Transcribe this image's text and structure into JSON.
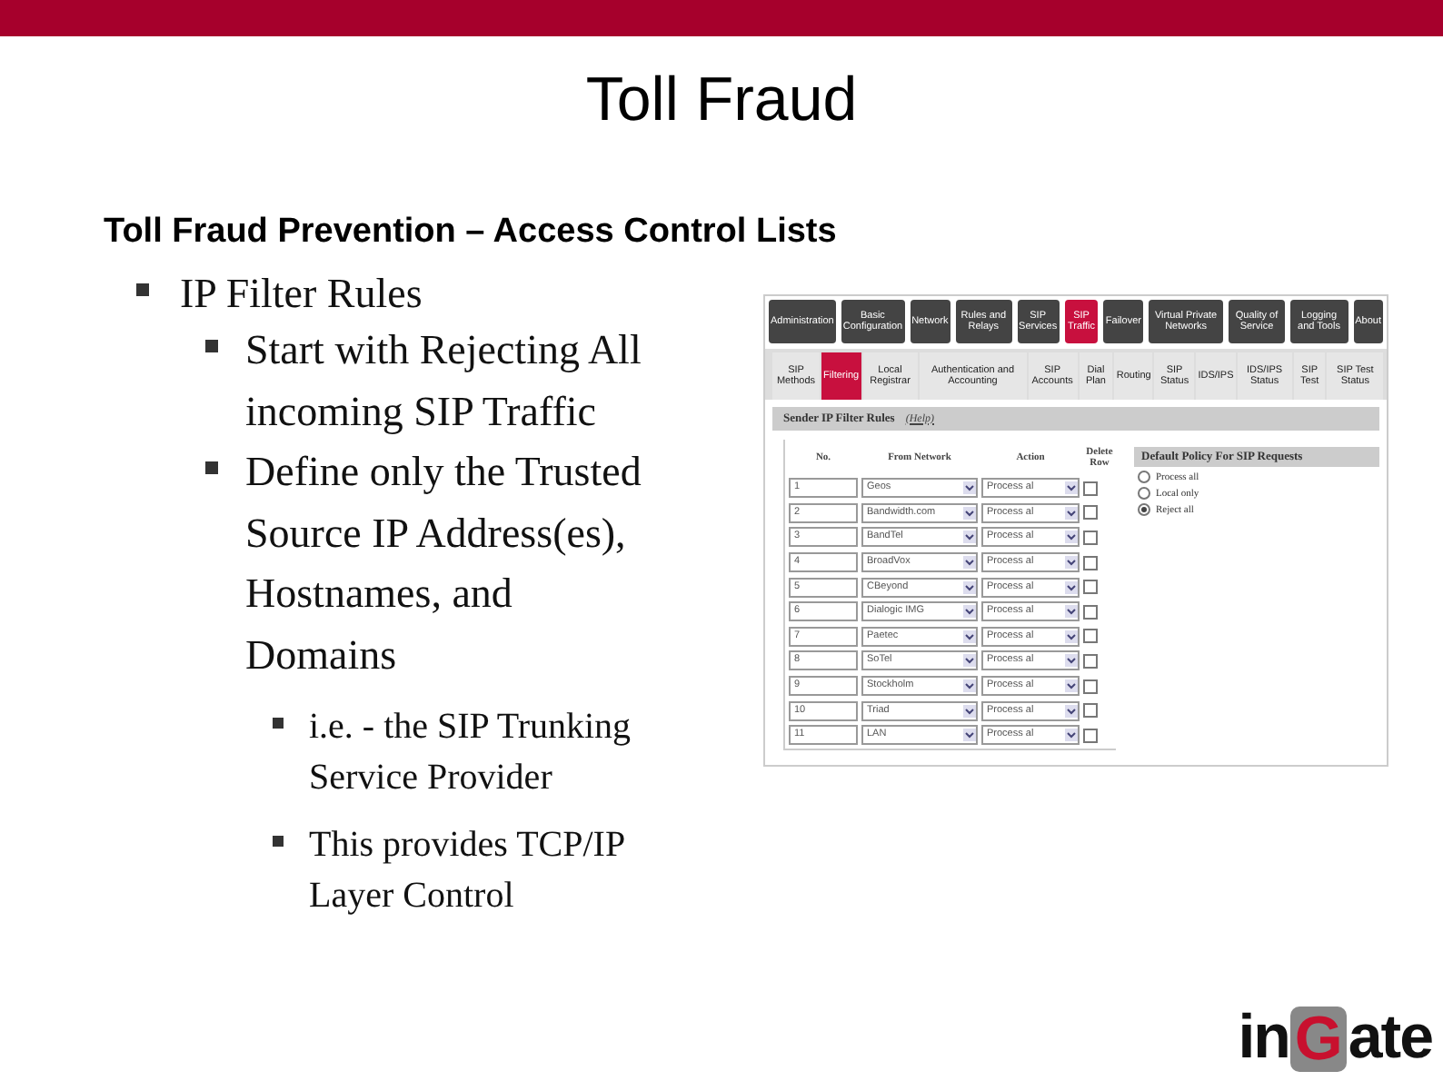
{
  "slide": {
    "title": "Toll Fraud",
    "subtitle": "Toll Fraud Prevention – Access Control Lists",
    "bullets": [
      {
        "text": "IP Filter Rules",
        "children": [
          {
            "text": "Start with Rejecting All incoming SIP Traffic"
          },
          {
            "text": "Define only the Trusted Source IP Address(es), Hostnames, and Domains",
            "children": [
              {
                "text": "i.e. - the SIP Trunking Service Provider"
              },
              {
                "text": "This provides TCP/IP Layer Control"
              }
            ]
          }
        ]
      }
    ]
  },
  "screenshot": {
    "main_tabs": [
      {
        "label": "Administration",
        "selected": false
      },
      {
        "label": "Basic Configuration",
        "selected": false
      },
      {
        "label": "Network",
        "selected": false
      },
      {
        "label": "Rules and Relays",
        "selected": false
      },
      {
        "label": "SIP Services",
        "selected": false
      },
      {
        "label": "SIP Traffic",
        "selected": true
      },
      {
        "label": "Failover",
        "selected": false
      },
      {
        "label": "Virtual Private Networks",
        "selected": false
      },
      {
        "label": "Quality of Service",
        "selected": false
      },
      {
        "label": "Logging and Tools",
        "selected": false
      },
      {
        "label": "About",
        "selected": false
      }
    ],
    "sub_tabs": [
      {
        "label": "SIP Methods",
        "selected": false
      },
      {
        "label": "Filtering",
        "selected": true
      },
      {
        "label": "Local Registrar",
        "selected": false
      },
      {
        "label": "Authentication and Accounting",
        "selected": false
      },
      {
        "label": "SIP Accounts",
        "selected": false
      },
      {
        "label": "Dial Plan",
        "selected": false
      },
      {
        "label": "Routing",
        "selected": false
      },
      {
        "label": "SIP Status",
        "selected": false
      },
      {
        "label": "IDS/IPS",
        "selected": false
      },
      {
        "label": "IDS/IPS Status",
        "selected": false
      },
      {
        "label": "SIP Test",
        "selected": false
      },
      {
        "label": "SIP Test Status",
        "selected": false
      }
    ],
    "section_title": "Sender IP Filter Rules",
    "help_link": "(Help)",
    "table": {
      "columns": [
        "No.",
        "From Network",
        "Action",
        "Delete Row"
      ],
      "rows": [
        {
          "no": "1",
          "network": "Geos",
          "action": "Process al",
          "delete": false
        },
        {
          "no": "2",
          "network": "Bandwidth.com",
          "action": "Process al",
          "delete": false
        },
        {
          "no": "3",
          "network": "BandTel",
          "action": "Process al",
          "delete": false
        },
        {
          "no": "4",
          "network": "BroadVox",
          "action": "Process al",
          "delete": false
        },
        {
          "no": "5",
          "network": "CBeyond",
          "action": "Process al",
          "delete": false
        },
        {
          "no": "6",
          "network": "Dialogic IMG",
          "action": "Process al",
          "delete": false
        },
        {
          "no": "7",
          "network": "Paetec",
          "action": "Process al",
          "delete": false
        },
        {
          "no": "8",
          "network": "SoTel",
          "action": "Process al",
          "delete": false
        },
        {
          "no": "9",
          "network": "Stockholm",
          "action": "Process al",
          "delete": false
        },
        {
          "no": "10",
          "network": "Triad",
          "action": "Process al",
          "delete": false
        },
        {
          "no": "11",
          "network": "LAN",
          "action": "Process al",
          "delete": false
        }
      ]
    },
    "policy": {
      "title": "Default Policy For SIP Requests",
      "options": [
        {
          "label": "Process all",
          "selected": false
        },
        {
          "label": "Local only",
          "selected": false
        },
        {
          "label": "Reject all",
          "selected": true
        }
      ]
    }
  },
  "logo": {
    "parts": [
      "in",
      "G",
      "ate"
    ]
  }
}
